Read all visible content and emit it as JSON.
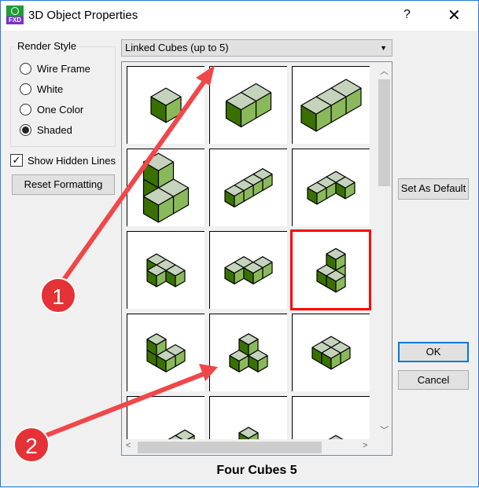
{
  "window": {
    "title": "3D Object Properties",
    "help_label": "?",
    "close_label": "✕",
    "icon_text": "FXD"
  },
  "render_style": {
    "label": "Render Style",
    "options": [
      {
        "label": "Wire Frame",
        "selected": false
      },
      {
        "label": "White",
        "selected": false
      },
      {
        "label": "One Color",
        "selected": false
      },
      {
        "label": "Shaded",
        "selected": true
      }
    ]
  },
  "show_hidden_lines": {
    "label": "Show Hidden Lines",
    "checked": true
  },
  "buttons": {
    "reset": "Reset Formatting",
    "set_default": "Set As Default",
    "ok": "OK",
    "cancel": "Cancel"
  },
  "category_dropdown": {
    "value": "Linked Cubes (up to 5)"
  },
  "gallery": {
    "selected_index": 8,
    "selected_name": "Four Cubes 5"
  },
  "annotations": [
    {
      "label": "1"
    },
    {
      "label": "2"
    }
  ],
  "colors": {
    "top": "#c5d3bd",
    "left": "#3a7000",
    "right": "#8ab95b",
    "selection": "#ff0000",
    "annotation": "#f0474a"
  }
}
